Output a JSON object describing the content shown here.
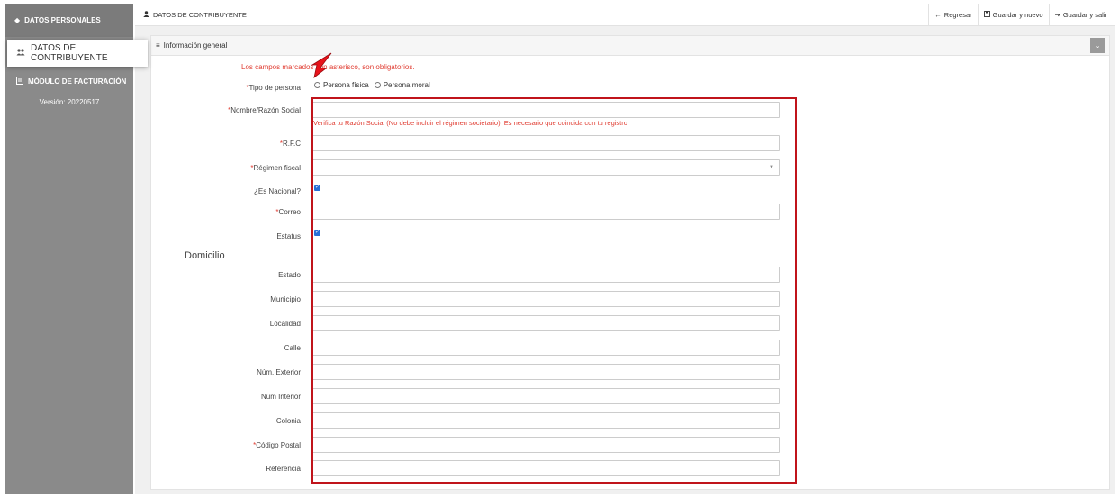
{
  "sidebar": {
    "header": "DATOS PERSONALES",
    "active_item": "DATOS DEL CONTRIBUYENTE",
    "billing_item": "MÓDULO DE FACTURACIÓN",
    "version": "Versión: 20220517"
  },
  "topbar": {
    "title": "DATOS DE CONTRIBUYENTE",
    "back": "Regresar",
    "save_new": "Guardar y nuevo",
    "save_exit": "Guardar y salir"
  },
  "panel": {
    "title": "Información general",
    "required_note": "Los campos marcados con asterisco, son obligatorios."
  },
  "form": {
    "tipo_persona": {
      "label": "Tipo de persona",
      "options": [
        "Persona física",
        "Persona moral"
      ]
    },
    "nombre": {
      "label": "Nombre/Razón Social",
      "hint": "Verifica tu Razón Social (No debe incluir el régimen societario). Es necesario que coincida con tu registro"
    },
    "rfc": {
      "label": "R.F.C"
    },
    "regimen": {
      "label": "Régimen fiscal"
    },
    "nacional": {
      "label": "¿Es Nacional?"
    },
    "correo": {
      "label": "Correo"
    },
    "estatus": {
      "label": "Estatus"
    },
    "domicilio_title": "Domicilio",
    "estado": {
      "label": "Estado"
    },
    "municipio": {
      "label": "Municipio"
    },
    "localidad": {
      "label": "Localidad"
    },
    "calle": {
      "label": "Calle"
    },
    "num_ext": {
      "label": "Núm. Exterior"
    },
    "num_int": {
      "label": "Núm Interior"
    },
    "colonia": {
      "label": "Colonia"
    },
    "cp": {
      "label": "Código Postal"
    },
    "referencia": {
      "label": "Referencia"
    }
  },
  "colors": {
    "required": "#e03c31",
    "highlight": "#c0141b",
    "checkbox": "#2a6fd6",
    "sidebar": "#8a8a8a"
  },
  "icons": {
    "sidebar_header": "diamond-icon",
    "users": "users-icon",
    "document": "document-icon",
    "user": "user-icon",
    "back": "arrow-left-icon",
    "save": "save-icon",
    "exit": "sign-out-icon",
    "menu": "hamburger-icon",
    "collapse": "chevron-down-icon",
    "annotation": "red-arrow-icon"
  }
}
